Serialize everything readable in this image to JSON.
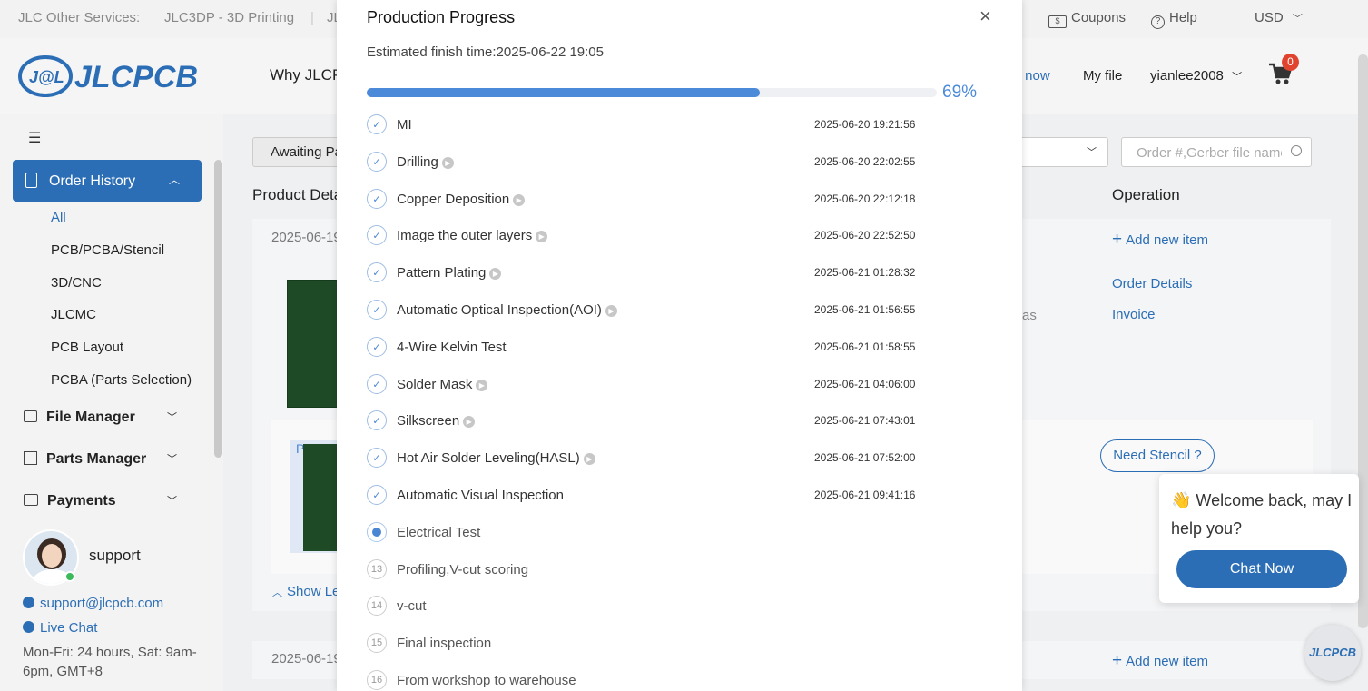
{
  "topbar": {
    "other_services": "JLC Other Services:",
    "service1": "JLC3DP - 3D Printing",
    "service2": "JL",
    "coupons": "Coupons",
    "help": "Help",
    "currency": "USD"
  },
  "header": {
    "logo": "JLCPCB",
    "nav_why": "Why JLCP",
    "nav_order_now": "r now",
    "nav_my_file": "My file",
    "user": "yianlee2008",
    "cart_count": "0"
  },
  "sidebar": {
    "order_history": "Order History",
    "sub_items": [
      "All",
      "PCB/PCBA/Stencil",
      "3D/CNC",
      "JLCMC",
      "PCB Layout",
      "PCBA (Parts Selection)"
    ],
    "file_manager": "File Manager",
    "parts_manager": "Parts Manager",
    "payments": "Payments",
    "support_name": "support",
    "support_email": "support@jlcpcb.com",
    "live_chat": "Live Chat",
    "hours_line1": "Mon-Fri: 24 hours, Sat: 9am-",
    "hours_line2": "6pm, GMT+8"
  },
  "main": {
    "filter_label": "Awaiting Pa",
    "search_placeholder": "Order #,Gerber file name",
    "col_product": "Product Deta",
    "col_operation": "Operation",
    "order_date": "2025-06-19",
    "order_date2": "2025-06-19",
    "add_new_item": "Add new item",
    "add_new_item2": "Add new item",
    "order_details": "Order Details",
    "invoice": "Invoice",
    "partial_text": "as",
    "pcb_tag": "PCB",
    "need_stencil": "Need Stencil ?",
    "show_less": "Show Le"
  },
  "modal": {
    "title": "Production Progress",
    "estimated": "Estimated finish time:2025-06-22 19:05",
    "progress_percent": 69,
    "progress_label": "69%",
    "accent_color": "#4a8ad9",
    "steps": [
      {
        "num": "1",
        "name": "MI",
        "time": "2025-06-20 19:21:56",
        "state": "done",
        "play": false
      },
      {
        "num": "2",
        "name": "Drilling",
        "time": "2025-06-20 22:02:55",
        "state": "done",
        "play": true
      },
      {
        "num": "3",
        "name": "Copper Deposition",
        "time": "2025-06-20 22:12:18",
        "state": "done",
        "play": true
      },
      {
        "num": "4",
        "name": "Image the outer layers",
        "time": "2025-06-20 22:52:50",
        "state": "done",
        "play": true
      },
      {
        "num": "5",
        "name": "Pattern Plating",
        "time": "2025-06-21 01:28:32",
        "state": "done",
        "play": true
      },
      {
        "num": "6",
        "name": "Automatic Optical Inspection(AOI)",
        "time": "2025-06-21 01:56:55",
        "state": "done",
        "play": true
      },
      {
        "num": "7",
        "name": "4-Wire Kelvin Test",
        "time": "2025-06-21 01:58:55",
        "state": "done",
        "play": false
      },
      {
        "num": "8",
        "name": "Solder Mask",
        "time": "2025-06-21 04:06:00",
        "state": "done",
        "play": true
      },
      {
        "num": "9",
        "name": "Silkscreen",
        "time": "2025-06-21 07:43:01",
        "state": "done",
        "play": true
      },
      {
        "num": "10",
        "name": "Hot Air Solder Leveling(HASL)",
        "time": "2025-06-21 07:52:00",
        "state": "done",
        "play": true
      },
      {
        "num": "11",
        "name": "Automatic Visual Inspection",
        "time": "2025-06-21 09:41:16",
        "state": "done",
        "play": false
      },
      {
        "num": "12",
        "name": "Electrical Test",
        "time": "",
        "state": "current",
        "play": false
      },
      {
        "num": "13",
        "name": "Profiling,V-cut scoring",
        "time": "",
        "state": "pending",
        "play": false
      },
      {
        "num": "14",
        "name": "v-cut",
        "time": "",
        "state": "pending",
        "play": false
      },
      {
        "num": "15",
        "name": "Final inspection",
        "time": "",
        "state": "pending",
        "play": false
      },
      {
        "num": "16",
        "name": "From workshop to warehouse",
        "time": "",
        "state": "pending",
        "play": false
      }
    ]
  },
  "chat": {
    "greeting_line1": "👋 Welcome back, may I",
    "greeting_line2": "help you?",
    "button": "Chat Now",
    "badge": "JLCPCB"
  }
}
